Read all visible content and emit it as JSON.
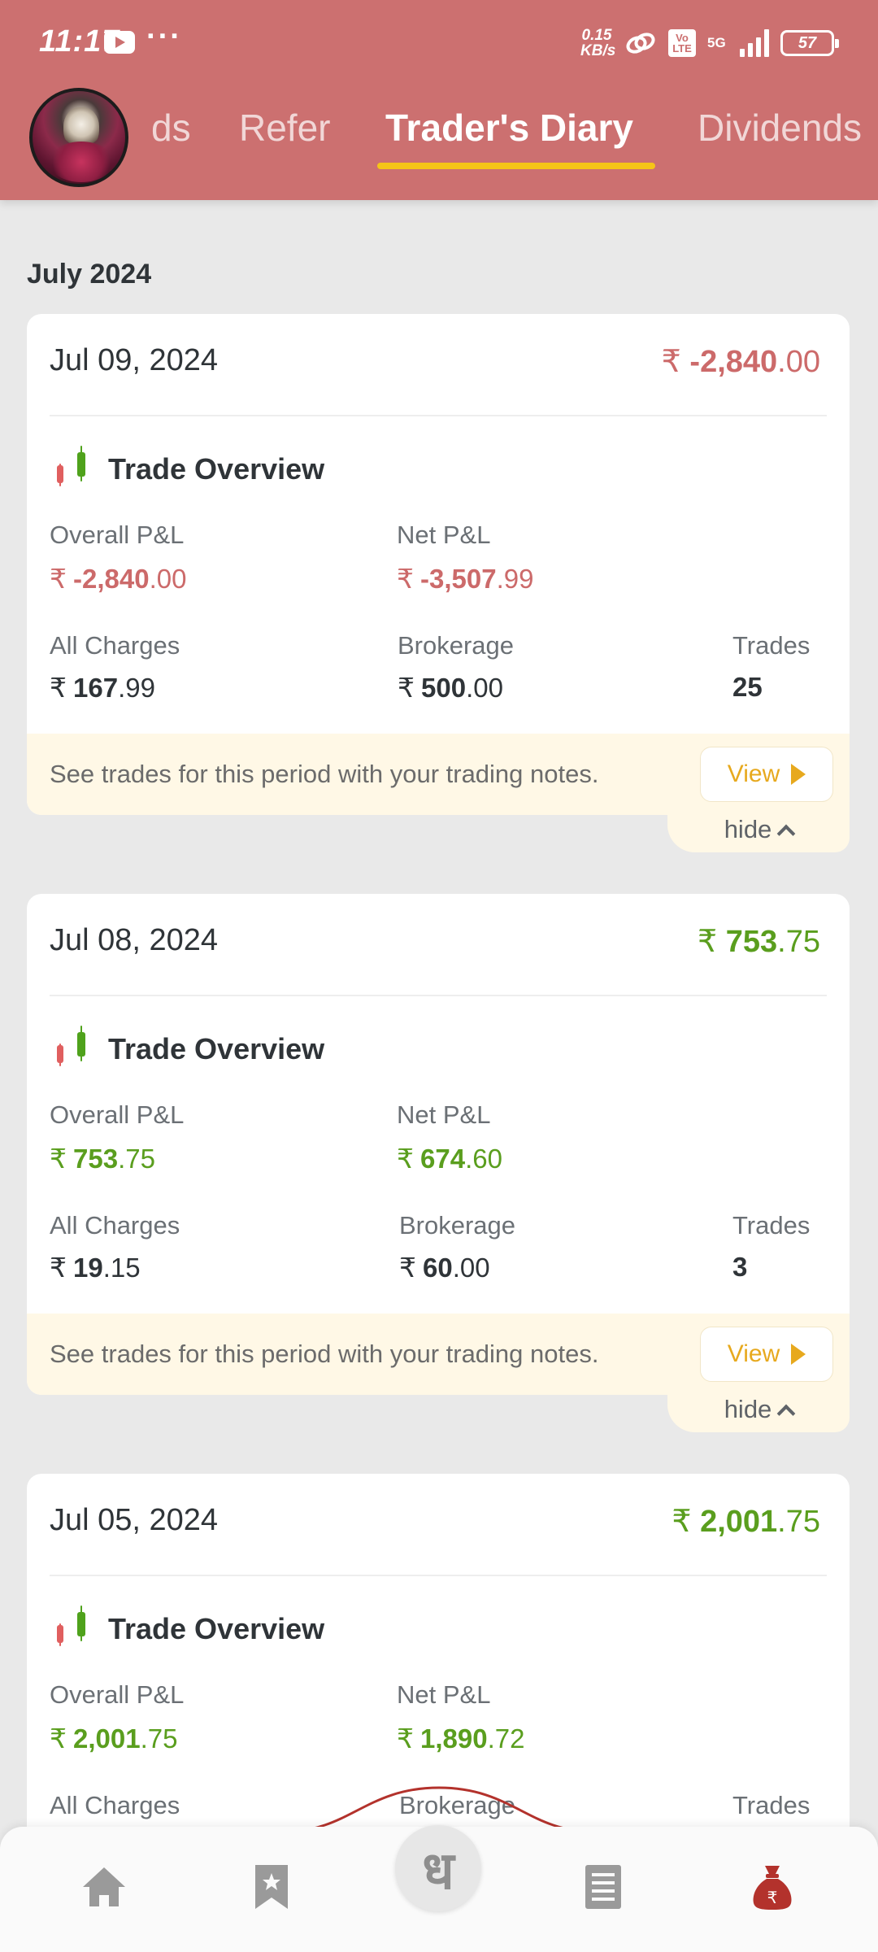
{
  "status_bar": {
    "time": "11:17",
    "speed_value": "0.15",
    "speed_unit": "KB/s",
    "volte": "Vo LTE",
    "network": "5G",
    "battery": "57"
  },
  "header": {
    "tabs": [
      {
        "label": "ds"
      },
      {
        "label": "Refer"
      },
      {
        "label": "Trader's Diary",
        "active": true
      },
      {
        "label": "Dividends"
      }
    ],
    "accent_color": "#cc7070",
    "underline_color": "#f5c518"
  },
  "month_label": "July 2024",
  "labels": {
    "trade_overview": "Trade Overview",
    "overall_pnl": "Overall P&L",
    "net_pnl": "Net P&L",
    "all_charges": "All Charges",
    "brokerage": "Brokerage",
    "trades": "Trades",
    "see_trades": "See trades for this period with your trading notes.",
    "view": "View",
    "hide": "hide",
    "currency": "₹"
  },
  "cards": [
    {
      "date": "Jul 09, 2024",
      "total": {
        "int": "-2,840",
        "dec": ".00"
      },
      "overall": {
        "int": "-2,840",
        "dec": ".00"
      },
      "net": {
        "int": "-3,507",
        "dec": ".99"
      },
      "charges": {
        "int": "167",
        "dec": ".99"
      },
      "brokerage": {
        "int": "500",
        "dec": ".00"
      },
      "trades": "25"
    },
    {
      "date": "Jul 08, 2024",
      "total": {
        "int": "753",
        "dec": ".75"
      },
      "overall": {
        "int": "753",
        "dec": ".75"
      },
      "net": {
        "int": "674",
        "dec": ".60"
      },
      "charges": {
        "int": "19",
        "dec": ".15"
      },
      "brokerage": {
        "int": "60",
        "dec": ".00"
      },
      "trades": "3"
    },
    {
      "date": "Jul 05, 2024",
      "total": {
        "int": "2,001",
        "dec": ".75"
      },
      "overall": {
        "int": "2,001",
        "dec": ".75"
      },
      "net": {
        "int": "1,890",
        "dec": ".72"
      }
    }
  ],
  "bottom_nav": {
    "items": [
      "home-icon",
      "bookmark-star-icon",
      "dhan-logo-icon",
      "orders-list-icon",
      "money-bag-icon"
    ],
    "center_glyph": "ध",
    "active_color": "#b3322c"
  },
  "colors": {
    "loss": "#cc6a6a",
    "profit": "#5a9e1e",
    "view_accent": "#e7a91e"
  }
}
